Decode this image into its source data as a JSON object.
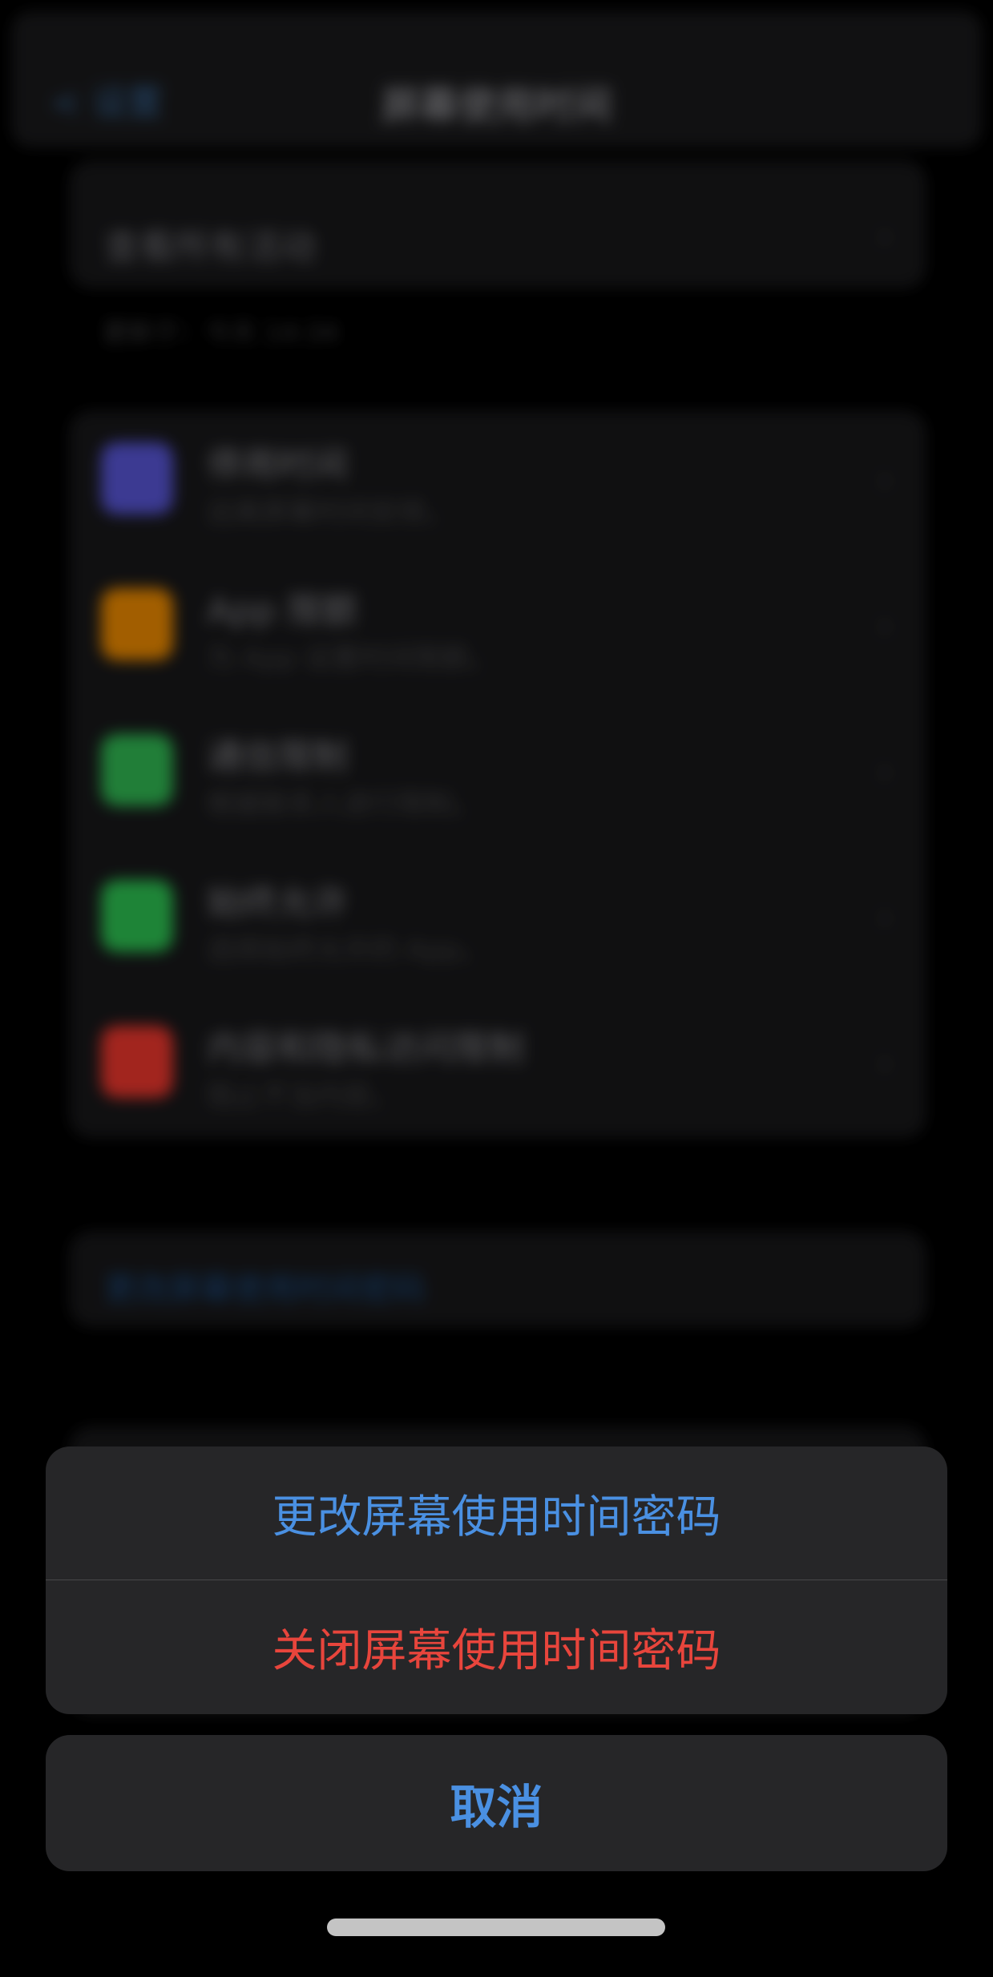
{
  "background": {
    "nav_back": "< 设置",
    "nav_title": "屏幕使用时间",
    "activity_label": "查看所有活动",
    "update_note": "更新于：今天 14:34",
    "list_items": [
      {
        "title": "停用时间",
        "subtitle": "远离屏幕时间安排。",
        "color": "#5e5ce6"
      },
      {
        "title": "App 限额",
        "subtitle": "为 App 设置时间限额。",
        "color": "#ff9500"
      },
      {
        "title": "通信限制",
        "subtitle": "根据联系人进行限制。",
        "color": "#34c759"
      },
      {
        "title": "始终允许",
        "subtitle": "选择始终允许的 App。",
        "color": "#30d158"
      },
      {
        "title": "内容和隐私访问限制",
        "subtitle": "阻止不当内容。",
        "color": "#ff3b30"
      }
    ],
    "change_link": "更改屏幕使用时间密码"
  },
  "action_sheet": {
    "change_passcode": "更改屏幕使用时间密码",
    "turn_off_passcode": "关闭屏幕使用时间密码",
    "cancel": "取消"
  }
}
